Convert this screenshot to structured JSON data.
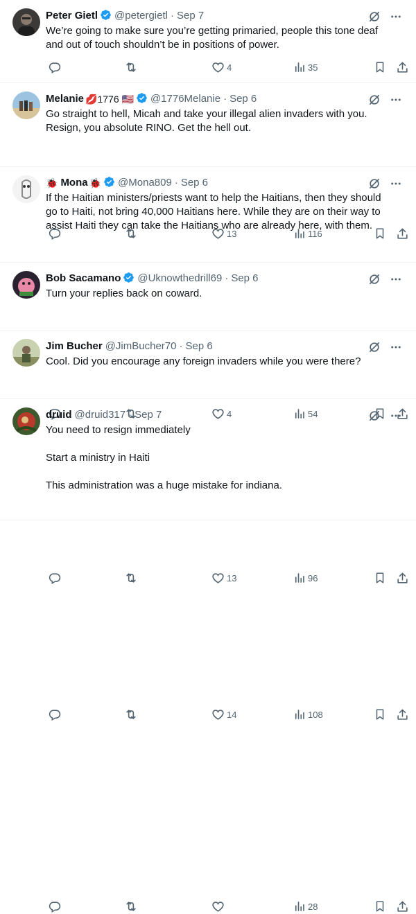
{
  "tweets": [
    {
      "name": "Peter Gietl",
      "emoji_before": "",
      "emoji_after": "",
      "verified": true,
      "handle": "@petergietl",
      "date": "Sep 7",
      "lines": [
        "We’re going to make sure you’re getting primaried, people this tone deaf",
        "and out of touch shouldn’t be in positions of power."
      ],
      "replies": "",
      "retweets": "",
      "likes": "4",
      "views": "35"
    },
    {
      "name": "Melanie",
      "emoji_before": "",
      "emoji_after": "💋1776 🇺🇸",
      "verified": true,
      "handle": "@1776Melanie",
      "date": "Sep 6",
      "lines": [
        "Go straight to hell, Micah and take your illegal alien invaders with you.",
        "Resign, you absolute RINO. Get the hell out."
      ],
      "replies": "",
      "retweets": "",
      "likes": "13",
      "views": "116"
    },
    {
      "name": "Mona",
      "emoji_before": "🐞",
      "emoji_after": "🐞",
      "verified": true,
      "handle": "@Mona809",
      "date": "Sep 6",
      "lines": [
        "If the Haitian ministers/priests want to help the Haitians, then they should",
        "go to Haiti, not bring 40,000 Haitians here. While they are on their way to",
        "assist Haiti they can take the Haitians who are already here, with them."
      ],
      "replies": "",
      "retweets": "",
      "likes": "4",
      "views": "54"
    },
    {
      "name": "Bob Sacamano",
      "emoji_before": "",
      "emoji_after": "",
      "verified": true,
      "handle": "@Uknowthedrill69",
      "date": "Sep 6",
      "lines": [
        "Turn your replies back on coward."
      ],
      "replies": "",
      "retweets": "",
      "likes": "13",
      "views": "96"
    },
    {
      "name": "Jim Bucher",
      "emoji_before": "",
      "emoji_after": "",
      "verified": false,
      "handle": "@JimBucher70",
      "date": "Sep 6",
      "lines": [
        "Cool.  Did you encourage any foreign invaders while you were there?"
      ],
      "replies": "",
      "retweets": "",
      "likes": "14",
      "views": "108"
    },
    {
      "name": "druid",
      "emoji_before": "",
      "emoji_after": "",
      "verified": false,
      "handle": "@druid317",
      "date": "Sep 7",
      "lines": [
        "You need to resign immediately",
        "",
        "Start a ministry in Haiti",
        "",
        "This administration was a huge mistake for indiana."
      ],
      "replies": "",
      "retweets": "",
      "likes": "",
      "views": "28"
    }
  ],
  "colors": {
    "text": "#0f1419",
    "muted": "#536471",
    "verified": "#1d9bf0",
    "divider": "#eff3f4"
  },
  "icons": [
    "reply-icon",
    "retweet-icon",
    "like-icon",
    "views-icon",
    "bookmark-icon",
    "share-icon",
    "grok-icon",
    "more-icon",
    "verified-badge-icon"
  ]
}
